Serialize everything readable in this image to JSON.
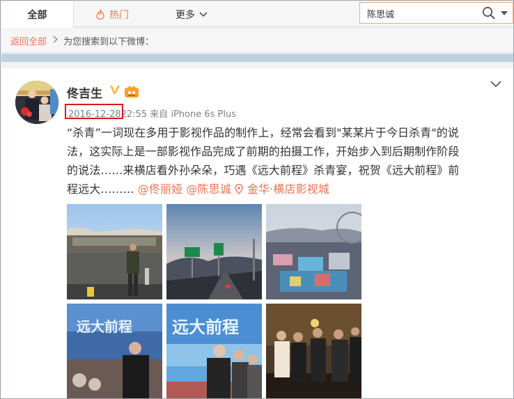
{
  "nav": {
    "tab_all": "全部",
    "tab_hot": "热门",
    "tab_more": "更多"
  },
  "search": {
    "value": "陈思诚"
  },
  "breadcrumb": {
    "back": "返回全部",
    "note": "为您搜索到以下微博："
  },
  "post": {
    "author": "佟吉生",
    "date": "2016-12-28",
    "time": "22:55",
    "source_prefix": "来自",
    "source": "iPhone 6s Plus",
    "lines": [
      "“杀青”一词现在多用于影视作品的制作上，经常会看到\"某某片于今日杀青\"的说",
      "法，这实际上是一部影视作品完成了前期的拍摄工作，开始步入到后期制作阶段",
      "的说法……来横店看外孙朵朵，巧遇《远大前程》杀青宴，祝贺《远大前程》前"
    ],
    "last_line": "程远大………",
    "mentions": [
      "@佟丽娅",
      "@陈思诚"
    ],
    "location": "金华·横店影视城",
    "photo_text": "远大前程"
  },
  "colors": {
    "accent": "#eb7350",
    "highlight": "#d41a1a",
    "band": "#bcd3df"
  }
}
